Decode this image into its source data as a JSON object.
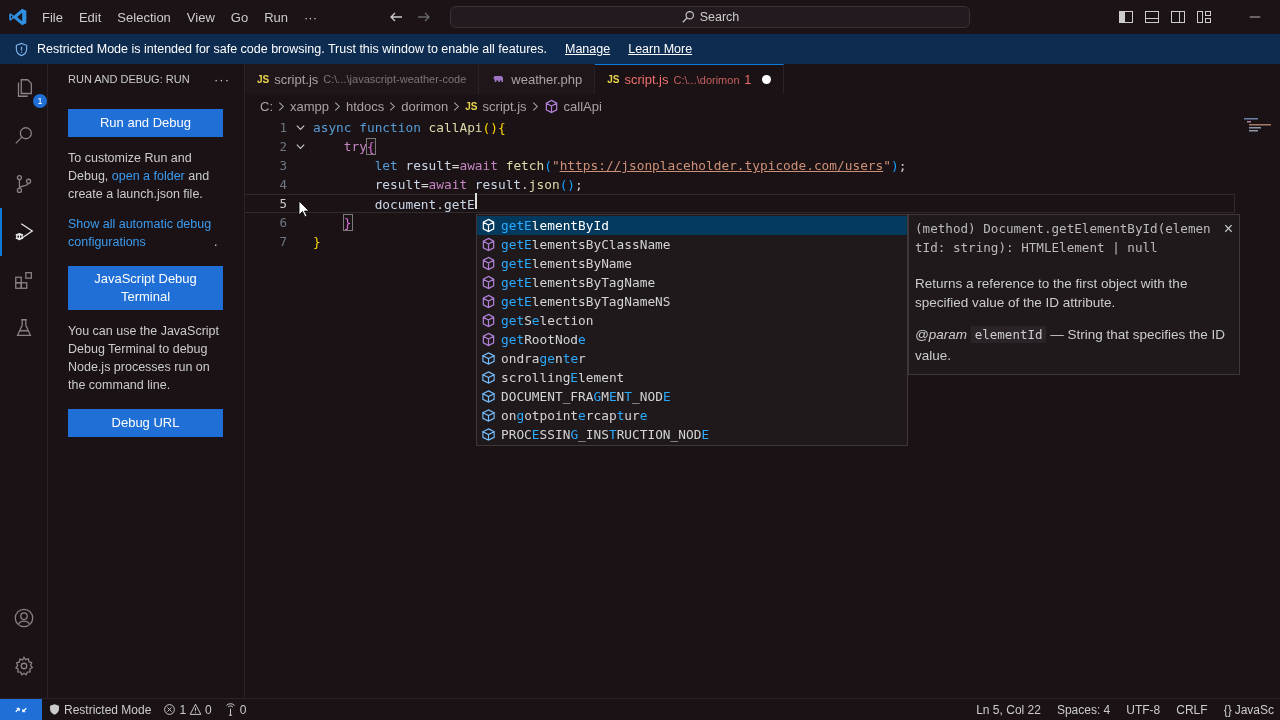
{
  "title_bar": {
    "menus": [
      "File",
      "Edit",
      "Selection",
      "View",
      "Go",
      "Run",
      "···"
    ],
    "nav": [
      {
        "disabled": false
      },
      {
        "disabled": true
      }
    ],
    "search": {
      "placeholder": "Search"
    }
  },
  "banner": {
    "text": "Restricted Mode is intended for safe code browsing. Trust this window to enable all features.",
    "links": [
      "Manage",
      "Learn More"
    ]
  },
  "activity_bar": {
    "items": [
      {
        "kind": "explorer",
        "selected": false,
        "badge": "1"
      },
      {
        "kind": "search",
        "selected": false
      },
      {
        "kind": "source-control",
        "selected": false
      },
      {
        "kind": "run-debug",
        "selected": true
      },
      {
        "kind": "extensions",
        "selected": false
      },
      {
        "kind": "testing",
        "selected": false
      }
    ],
    "bottom": [
      {
        "kind": "accounts"
      },
      {
        "kind": "settings"
      }
    ]
  },
  "sidebar": {
    "title": "RUN AND DEBUG: RUN",
    "more": "···",
    "sections": [
      {
        "kind": "button",
        "label": "Run and Debug"
      },
      {
        "kind": "text",
        "parts": [
          {
            "text": "To customize Run and Debug, ",
            "link": false
          },
          {
            "text": "open a folder",
            "link": true
          },
          {
            "text": " and create a launch.json file.",
            "link": false
          }
        ]
      },
      {
        "kind": "text",
        "parts": [
          {
            "text": "Show all automatic debug configurations",
            "link": true
          },
          {
            "text": ".",
            "link": false
          }
        ]
      },
      {
        "kind": "button",
        "label": "JavaScript Debug Terminal"
      },
      {
        "kind": "text",
        "parts": [
          {
            "text": "You can use the JavaScript Debug Terminal to debug Node.js processes run on the command line.",
            "link": false
          }
        ]
      },
      {
        "kind": "button",
        "label": "Debug URL"
      }
    ]
  },
  "tabs": [
    {
      "kind": "js",
      "file_badge": "JS",
      "name": "script.js",
      "path": "C:\\...\\javascript-weather-code",
      "selected": false,
      "modified": false,
      "error": false
    },
    {
      "kind": "php",
      "name": "weather.php",
      "selected": false,
      "modified": false,
      "error": false
    },
    {
      "kind": "js",
      "file_badge": "JS",
      "name": "script.js",
      "path": "C:\\...\\dorimon",
      "problems": "1",
      "selected": true,
      "modified": true,
      "error": true
    }
  ],
  "breadcrumbs": [
    {
      "kind": "folder",
      "text": "C:"
    },
    {
      "kind": "folder",
      "text": "xampp"
    },
    {
      "kind": "folder",
      "text": "htdocs"
    },
    {
      "kind": "folder",
      "text": "dorimon"
    },
    {
      "kind": "file",
      "file_badge": "JS",
      "text": "script.js"
    },
    {
      "kind": "symbol",
      "text": "callApi"
    }
  ],
  "editor": {
    "lines": [
      {
        "number": "1",
        "expanded": true,
        "current": false,
        "tokens": [
          {
            "text": "async",
            "kind": "keyword"
          },
          {
            "text": " function",
            "kind": "keyword"
          },
          {
            "text": " callApi",
            "kind": "function"
          },
          {
            "text": "(){",
            "kind": "bracket-1"
          }
        ]
      },
      {
        "number": "2",
        "expanded": true,
        "current": false,
        "tokens": [
          {
            "text": "    try",
            "kind": "control"
          },
          {
            "text": "{",
            "kind": "bracket-match"
          }
        ]
      },
      {
        "number": "3",
        "current": false,
        "tokens": [
          {
            "text": "        let",
            "kind": "keyword"
          },
          {
            "text": " result",
            "kind": "variable"
          },
          {
            "text": "=",
            "kind": "punctuation"
          },
          {
            "text": "await",
            "kind": "control"
          },
          {
            "text": " fetch",
            "kind": "function"
          },
          {
            "text": "(",
            "kind": "bracket-3"
          },
          {
            "text": "\"",
            "kind": "string"
          },
          {
            "text": "https://jsonplaceholder.typicode.com/users",
            "kind": "link"
          },
          {
            "text": "\"",
            "kind": "string"
          },
          {
            "text": ")",
            "kind": "bracket-3"
          },
          {
            "text": ";",
            "kind": "punctuation"
          }
        ]
      },
      {
        "number": "4",
        "current": false,
        "tokens": [
          {
            "text": "        result",
            "kind": "variable"
          },
          {
            "text": "=",
            "kind": "punctuation"
          },
          {
            "text": "await",
            "kind": "control"
          },
          {
            "text": " result",
            "kind": "variable"
          },
          {
            "text": ".",
            "kind": "punctuation"
          },
          {
            "text": "json",
            "kind": "function"
          },
          {
            "text": "()",
            "kind": "bracket-3"
          },
          {
            "text": ";",
            "kind": "punctuation"
          }
        ]
      },
      {
        "number": "5",
        "current": true,
        "tokens": [
          {
            "text": "        document",
            "kind": "variable"
          },
          {
            "text": ".",
            "kind": "punctuation"
          },
          {
            "text": "getE",
            "kind": "variable"
          }
        ]
      },
      {
        "number": "6",
        "current": false,
        "tokens": [
          {
            "text": "    }",
            "kind": "bracket-match"
          }
        ]
      },
      {
        "number": "7",
        "current": false,
        "tokens": [
          {
            "text": "}",
            "kind": "bracket-1"
          }
        ]
      }
    ]
  },
  "suggestions": {
    "items": [
      {
        "label": "**getE**lementById",
        "kind": "method",
        "selected": true
      },
      {
        "label": "**getE**lementsByClassName",
        "kind": "method",
        "selected": false
      },
      {
        "label": "**getE**lementsByName",
        "kind": "method",
        "selected": false
      },
      {
        "label": "**getE**lementsByTagName",
        "kind": "method",
        "selected": false
      },
      {
        "label": "**getE**lementsByTagNameNS",
        "kind": "method",
        "selected": false
      },
      {
        "label": "**get**S**e**lection",
        "kind": "method",
        "selected": false
      },
      {
        "label": "**get**RootNod**e**",
        "kind": "method",
        "selected": false
      },
      {
        "label": "ondra**ge**n**te**r",
        "kind": "property",
        "selected": false
      },
      {
        "label": "scrolling**E**lement",
        "kind": "property",
        "selected": false
      },
      {
        "label": "DOCUMENT_FRA**G**M**E**N**T**_NOD**E**",
        "kind": "property",
        "selected": false
      },
      {
        "label": "on**g**otpoint**e**rcap**t**ur**e**",
        "kind": "property",
        "selected": false
      },
      {
        "label": "PROC**E**SSIN**G**_INS**T**RUCTION_NOD**E**",
        "kind": "property",
        "selected": false
      }
    ],
    "details": {
      "signature": "(method) Document.getElementById(elementId: string): HTMLElement | null",
      "close": "×",
      "description": "Returns a reference to the first object with the specified value of the ID attribute.",
      "param_tag": "@param",
      "param_name": "elementId",
      "param_text": "— String that specifies the ID value."
    }
  },
  "status_bar": {
    "restricted": "Restricted Mode",
    "errors": "1",
    "warnings": "0",
    "ports": "0",
    "right": [
      "Ln 5, Col 22",
      "Spaces: 4",
      "UTF-8",
      "CRLF"
    ],
    "language_icon": "{}",
    "language": "JavaSc"
  }
}
